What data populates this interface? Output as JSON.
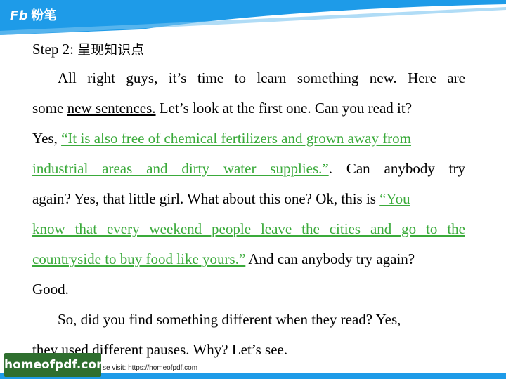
{
  "header": {
    "logo_mark": "Fb",
    "logo_text": "粉笔"
  },
  "colors": {
    "header_blue": "#1e9be8",
    "link_green": "#3aaa3a",
    "watermark_green": "#2f6f2f"
  },
  "step": {
    "label": "Step 2: ",
    "title_cn": "呈现知识点"
  },
  "paragraph1": {
    "line1": "All right guys, it’s time to learn something new. Here are",
    "line2_pre": "some ",
    "line2_underlined": "new sentences.",
    "line2_post": "  Let’s look at the first one. Can you read it?",
    "line3_pre": "Yes, ",
    "line3_quote": "“It is also free of chemical fertilizers and grown away from",
    "line4_quote": "industrial areas and dirty water supplies.”",
    "line4_post": ". Can anybody try",
    "line5_pre": "again? Yes, that little girl. What about this one? Ok, this is ",
    "line5_quote": "“You",
    "line6_quote": "know that every weekend people leave the cities and go to the",
    "line7_quote": "countryside to buy food like yours.”",
    "line7_post": " And can anybody try again?",
    "line8": "Good."
  },
  "paragraph2": {
    "line1": "So, did you find something different when they read? Yes,",
    "line2": "they used different pauses. Why? Let’s see."
  },
  "watermark": {
    "badge": "homeofpdf.com",
    "text": "se visit: https://homeofpdf.com"
  }
}
